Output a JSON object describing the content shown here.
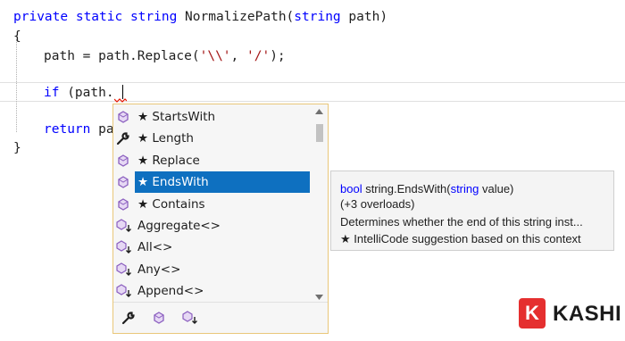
{
  "code": {
    "line1": {
      "kw": "private static string",
      "name": " NormalizePath(",
      "kw2": "string",
      "rest": " path)"
    },
    "line2": "{",
    "line3": {
      "pre": "path = path.Replace(",
      "s1": "'\\\\'",
      "mid": ", ",
      "s2": "'/'",
      "post": ");"
    },
    "line4": {
      "kw": "if",
      "rest": " (path."
    },
    "line5": {
      "kw": "return",
      "rest": " pa"
    },
    "line6": "}"
  },
  "completion": {
    "items": [
      {
        "label": "★ StartsWith",
        "icon": "method-icon"
      },
      {
        "label": "★ Length",
        "icon": "wrench-icon"
      },
      {
        "label": "★ Replace",
        "icon": "method-icon"
      },
      {
        "label": "★ EndsWith",
        "icon": "method-icon",
        "selected": true
      },
      {
        "label": "★ Contains",
        "icon": "method-icon"
      },
      {
        "label": "Aggregate<>",
        "icon": "extension-method-icon"
      },
      {
        "label": "All<>",
        "icon": "extension-method-icon"
      },
      {
        "label": "Any<>",
        "icon": "extension-method-icon"
      },
      {
        "label": "Append<>",
        "icon": "extension-method-icon"
      }
    ],
    "filters": [
      "wrench-icon",
      "method-icon",
      "extension-method-icon"
    ]
  },
  "tooltip": {
    "sig_kw": "bool",
    "sig_type": " string.",
    "sig_name": "EndsWith(",
    "sig_param_kw": "string",
    "sig_param": " value)",
    "overloads": "(+3 overloads)",
    "description": "Determines whether the end of this string inst...",
    "intellicode": "★ IntelliCode suggestion based on this context"
  },
  "brand": {
    "letter": "K",
    "name": "KASHI"
  },
  "colors": {
    "keyword": "#0000ff",
    "string": "#a31515",
    "selection": "#0e70c0",
    "popup_border": "#e9c77a",
    "method_purple": "#8b5fbf"
  }
}
